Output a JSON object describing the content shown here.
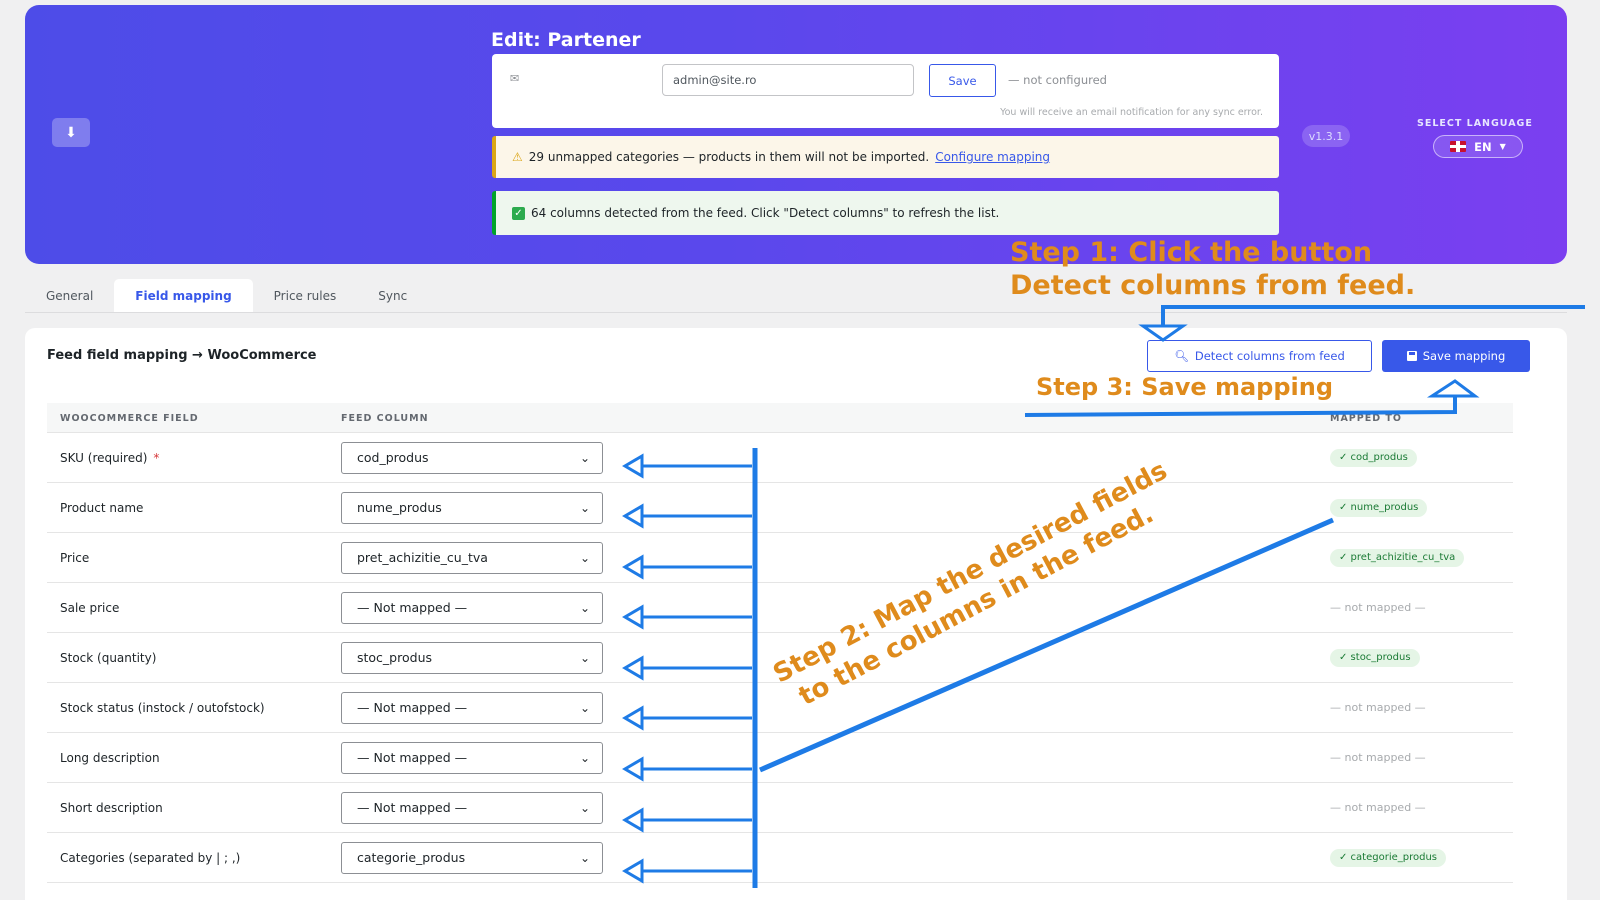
{
  "header": {
    "title": "Edit: Partener",
    "download_icon": "download-icon",
    "email": {
      "icon": "envelope-icon",
      "icon_glyph": "✉",
      "value": "admin@site.ro",
      "save_label": "Save",
      "status": "— not configured",
      "note": "You will receive an email notification for any sync error."
    },
    "warning": {
      "icon": "warning-icon",
      "text": "29 unmapped categories — products in them will not be imported.",
      "link": "Configure mapping"
    },
    "success": {
      "icon": "checkbox-icon",
      "text": "64 columns detected from the feed. Click \"Detect columns\" to refresh the list."
    },
    "version": "v1.3.1",
    "language": {
      "label": "SELECT LANGUAGE",
      "flag_icon": "uk-flag-icon",
      "value": "EN"
    },
    "colors": {
      "gradient_start": "#4d4ce8",
      "gradient_end": "#7b3ff0"
    }
  },
  "tabs": [
    {
      "label": "General",
      "active": false
    },
    {
      "label": "Field mapping",
      "active": true
    },
    {
      "label": "Price rules",
      "active": false
    },
    {
      "label": "Sync",
      "active": false
    }
  ],
  "mapping": {
    "title": "Feed field mapping → WooCommerce",
    "detect_label": "Detect columns from feed",
    "save_label": "Save mapping",
    "columns": [
      "WOOCOMMERCE FIELD",
      "FEED COLUMN",
      "MAPPED TO"
    ],
    "rows": [
      {
        "field": "SKU (required)",
        "required": "*",
        "column": "cod_produs",
        "mapped": "✓ cod_produs"
      },
      {
        "field": "Product name",
        "column": "nume_produs",
        "mapped": "✓ nume_produs"
      },
      {
        "field": "Price",
        "column": "pret_achizitie_cu_tva",
        "mapped": "✓ pret_achizitie_cu_tva"
      },
      {
        "field": "Sale price",
        "column": "— Not mapped —",
        "unmapped": "— not mapped —"
      },
      {
        "field": "Stock (quantity)",
        "column": "stoc_produs",
        "mapped": "✓ stoc_produs"
      },
      {
        "field": "Stock status (instock / outofstock)",
        "column": "— Not mapped —",
        "unmapped": "— not mapped —"
      },
      {
        "field": "Long description",
        "column": "— Not mapped —",
        "unmapped": "— not mapped —"
      },
      {
        "field": "Short description",
        "column": "— Not mapped —",
        "unmapped": "— not mapped —"
      },
      {
        "field": "Categories (separated by | ; ,)",
        "column": "categorie_produs",
        "mapped": "✓ categorie_produs"
      }
    ]
  },
  "annotations": {
    "step1_line1": "Step 1: Click the button",
    "step1_line2": "Detect columns from feed.",
    "step2_line1": "Step 2: Map the desired fields",
    "step2_line2": "to the columns in the feed.",
    "step3": "Step 3: Save mapping",
    "text_color": "#df8b1c",
    "arrow_color": "#1e7be6"
  }
}
